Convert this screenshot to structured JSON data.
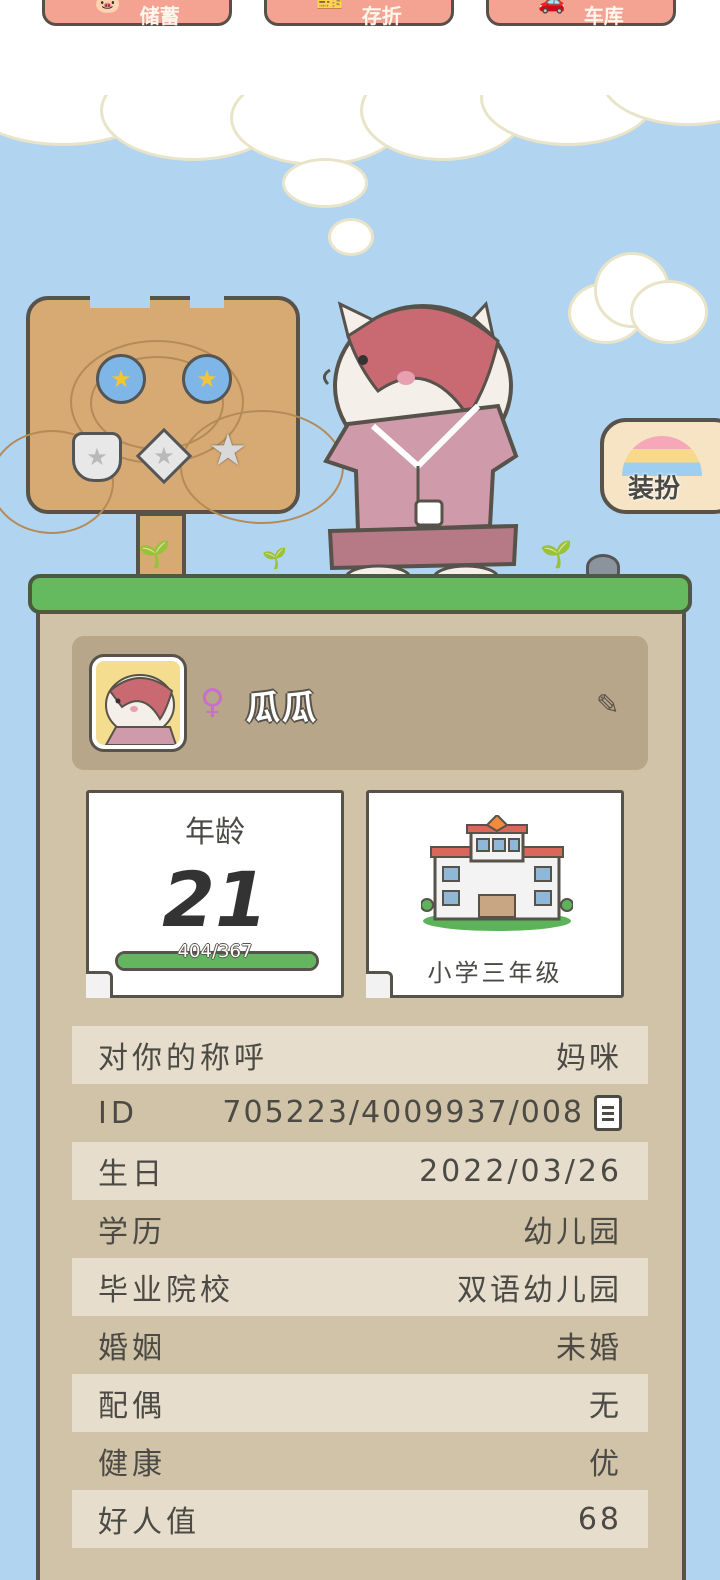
{
  "top_buttons": [
    {
      "label": "储蓄",
      "icon": "piggy-bank-icon"
    },
    {
      "label": "存折",
      "icon": "ticket-icon"
    },
    {
      "label": "车库",
      "icon": "car-icon"
    }
  ],
  "signboard": {
    "badges": [
      "flower-badge-icon",
      "flower-badge-icon",
      "shield-badge-icon",
      "diamond-badge-icon",
      "star-badge-icon"
    ]
  },
  "dress_up": {
    "label": "装扮"
  },
  "profile": {
    "gender_symbol": "♀",
    "name": "瓜瓜"
  },
  "age_card": {
    "label": "年龄",
    "value": "21",
    "exp_text": "404/367",
    "exp_fraction": 1.0
  },
  "school_card": {
    "label": "小学三年级"
  },
  "info_rows": [
    {
      "key": "对你的称呼",
      "value": "妈咪"
    },
    {
      "key": "ID",
      "value": "705223/4009937/008"
    },
    {
      "key": "生日",
      "value": "2022/03/26"
    },
    {
      "key": "学历",
      "value": "幼儿园"
    },
    {
      "key": "毕业院校",
      "value": "双语幼儿园"
    },
    {
      "key": "婚姻",
      "value": "未婚"
    },
    {
      "key": "配偶",
      "value": "无"
    },
    {
      "key": "健康",
      "value": "优"
    },
    {
      "key": "好人值",
      "value": "68"
    }
  ],
  "colors": {
    "sky": "#b1d4f1",
    "panel": "#d1c3a8",
    "grass": "#65b95e",
    "button": "#f4a291",
    "gender": "#c86ed0"
  }
}
